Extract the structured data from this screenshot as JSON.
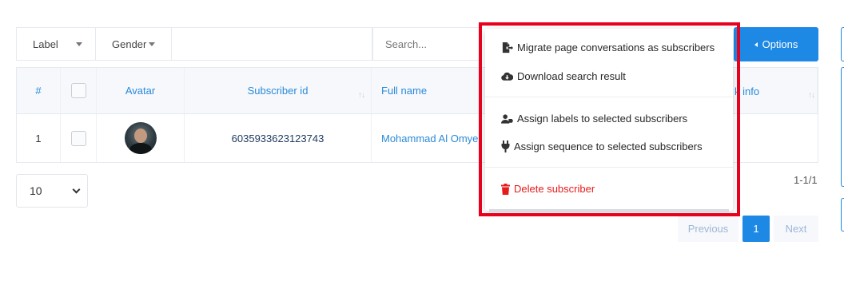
{
  "filters": {
    "label": "Label",
    "gender": "Gender",
    "search_placeholder": "Search..."
  },
  "options_button": {
    "label": "Options"
  },
  "table": {
    "headers": {
      "num": "#",
      "avatar": "Avatar",
      "subscriber_id": "Subscriber id",
      "full_name": "Full name",
      "info_partial": "k info"
    },
    "rows": [
      {
        "num": "1",
        "subscriber_id": "6035933623123743",
        "full_name": "Mohammad Al Omye"
      }
    ]
  },
  "page_size": {
    "value": "10"
  },
  "count_text": "1-1/1",
  "pagination": {
    "previous": "Previous",
    "current": "1",
    "next": "Next"
  },
  "dropdown": {
    "migrate": "Migrate page conversations as subscribers",
    "download": "Download search result",
    "assign_labels": "Assign labels to selected subscribers",
    "assign_sequence": "Assign sequence to selected subscribers",
    "delete": "Delete subscriber"
  },
  "colors": {
    "accent": "#1e88e5",
    "highlight": "#e8001c",
    "danger": "#e81b1b"
  }
}
